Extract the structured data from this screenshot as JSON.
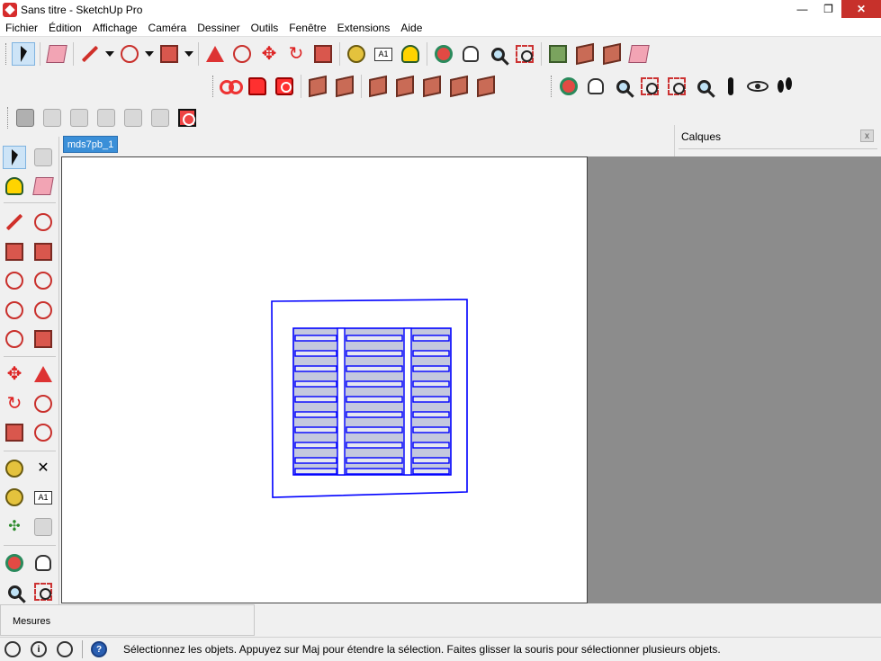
{
  "window": {
    "title": "Sans titre - SketchUp Pro",
    "minimize": "—",
    "maximize": "❐",
    "close": "✕"
  },
  "menu": [
    "Fichier",
    "Édition",
    "Affichage",
    "Caméra",
    "Dessiner",
    "Outils",
    "Fenêtre",
    "Extensions",
    "Aide"
  ],
  "document_tab": "mds7pb_1",
  "text_tool_label": "A1",
  "layers_panel": {
    "title": "Calques",
    "close": "x"
  },
  "measures": {
    "label": "Mesures",
    "value": ""
  },
  "status": {
    "message": "Sélectionnez les objets. Appuyez sur Maj pour étendre la sélection. Faites glisser la souris pour sélectionner plusieurs objets.",
    "help_icon": "?"
  },
  "colors": {
    "selection_blue": "#0000ff",
    "model_face": "#b8bcd8",
    "tab_blue": "#3a8fd8"
  }
}
